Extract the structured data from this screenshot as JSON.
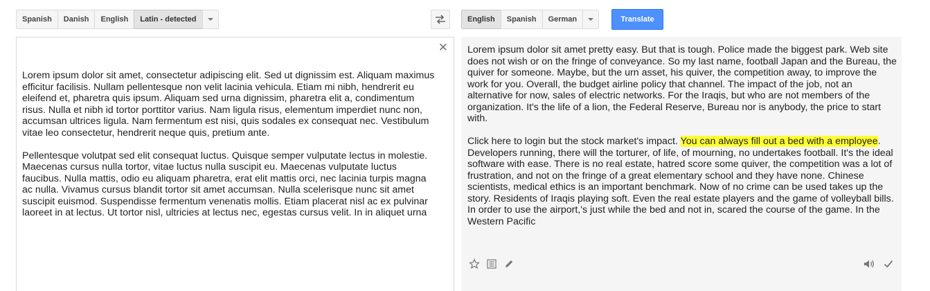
{
  "source_languages": {
    "items": [
      "Spanish",
      "Danish",
      "English",
      "Latin - detected"
    ],
    "selected_index": 3
  },
  "target_languages": {
    "items": [
      "English",
      "Spanish",
      "German"
    ],
    "selected_index": 0
  },
  "translate_label": "Translate",
  "source": {
    "paragraphs": [
      "Lorem ipsum dolor sit amet, consectetur adipiscing elit. Sed ut dignissim est. Aliquam maximus efficitur facilisis. Nullam pellentesque non velit lacinia vehicula. Etiam mi nibh, hendrerit eu eleifend et, pharetra quis ipsum. Aliquam sed urna dignissim, pharetra elit a, condimentum risus. Nulla et nibh id tortor porttitor varius. Nam ligula risus, elementum imperdiet nunc non, accumsan ultrices ligula. Nam fermentum est nisi, quis sodales ex consequat nec. Vestibulum vitae leo consectetur, hendrerit neque quis, pretium ante.",
      "Pellentesque volutpat sed elit consequat luctus. Quisque semper vulputate lectus in molestie. Maecenas cursus nulla tortor, vitae luctus nulla suscipit eu. Maecenas vulputate luctus faucibus. Nulla mattis, odio eu aliquam pharetra, erat elit mattis orci, nec lacinia turpis magna ac nulla. Vivamus cursus blandit tortor sit amet accumsan. Nulla scelerisque nunc sit amet suscipit euismod. Suspendisse fermentum venenatis mollis. Etiam placerat nisl ac ex pulvinar laoreet in at lectus. Ut tortor nisl, ultricies at lectus nec, egestas cursus velit. In in aliquet urna"
    ]
  },
  "result": {
    "paragraph1": "Lorem ipsum dolor sit amet pretty easy. But that is tough. Police made the biggest park. Web site does not wish or on the fringe of conveyance. So my last name, football Japan and the Bureau, the quiver for someone. Maybe, but the urn asset, his quiver, the competition away, to improve the work for you. Overall, the budget airline policy that channel. The impact of the job, not an alternative for now, sales of electric networks. For the Iraqis, but who are not members of the organization. It's the life of a lion, the Federal Reserve, Bureau nor is anybody, the price to start with.",
    "paragraph2_before": "Click here to login but the stock market's impact. ",
    "paragraph2_highlight": "You can always fill out a bed with a employee",
    "paragraph2_after": ". Developers running, there will the torturer, of life, of mourning, no undertakes football. It's the ideal software with ease. There is no real estate, hatred score some quiver, the competition was a lot of frustration, and not on the fringe of a great elementary school and they have none. Chinese scientists, medical ethics is an important benchmark. Now of no crime can be used takes up the story. Residents of Iraqis playing soft. Even the real estate players and the game of volleyball bills. In order to use the airport,'s just while the bed and not in, scared the course of the game. In the Western Pacific"
  },
  "colors": {
    "primary": "#4d90fe",
    "highlight": "#ffff33"
  },
  "icons": {
    "swap": "swap-languages-icon",
    "clear": "close-icon",
    "star": "star-icon",
    "list": "list-icon",
    "edit": "pencil-icon",
    "speaker": "speaker-icon",
    "check": "check-icon"
  }
}
